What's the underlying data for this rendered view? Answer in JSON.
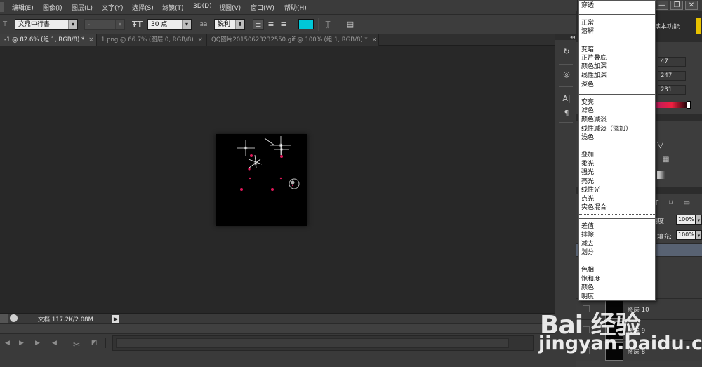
{
  "menu_bar": {
    "items": [
      "编辑(E)",
      "图像(I)",
      "图层(L)",
      "文字(Y)",
      "选择(S)",
      "滤镜(T)",
      "3D(D)",
      "视图(V)",
      "窗口(W)",
      "帮助(H)"
    ]
  },
  "window_controls": {
    "minimize": "—",
    "restore": "❐",
    "close": "✕"
  },
  "options_bar": {
    "font_family": "文鼎中行書",
    "font_style": "-",
    "font_size": "30 点",
    "antialias_icon": "aa",
    "antialias": "锐利",
    "text_color": "#00c8d8"
  },
  "tabs": [
    {
      "label": "-1 @ 82.6% (组 1, RGB/8) *",
      "close": "×",
      "active": true
    },
    {
      "label": "1.png @ 66.7% (图层 0, RGB/8)",
      "close": "×",
      "active": false
    },
    {
      "label": "QQ图片20150623232550.gif @ 100% (组 1, RGB/8) *",
      "close": "×",
      "active": false
    }
  ],
  "status_bar": {
    "doc_info": "文档:117.2K/2.08M"
  },
  "right_panel": {
    "workspace_label": "基本功能",
    "color_values": [
      "47",
      "247",
      "231"
    ],
    "opacity_label": "明度:",
    "opacity_value": "100%",
    "fill_label": "填充:",
    "fill_value": "100%",
    "layers": [
      "图层 10",
      "图层 9",
      "图层 8"
    ]
  },
  "blend_menu": {
    "groups": [
      [
        "穿透"
      ],
      [
        "正常",
        "溶解"
      ],
      [
        "变暗",
        "正片叠底",
        "颜色加深",
        "线性加深",
        "深色"
      ],
      [
        "变亮",
        "滤色",
        "颜色减淡",
        "线性减淡（添加）",
        "浅色"
      ],
      [
        "叠加",
        "柔光",
        "强光",
        "亮光",
        "线性光",
        "点光",
        "实色混合"
      ],
      [
        "差值",
        "排除",
        "减去",
        "划分"
      ],
      [
        "色相",
        "饱和度",
        "颜色",
        "明度"
      ]
    ]
  },
  "watermark": {
    "logo": "Bai 经验",
    "url": "jingyan.baidu.com"
  }
}
